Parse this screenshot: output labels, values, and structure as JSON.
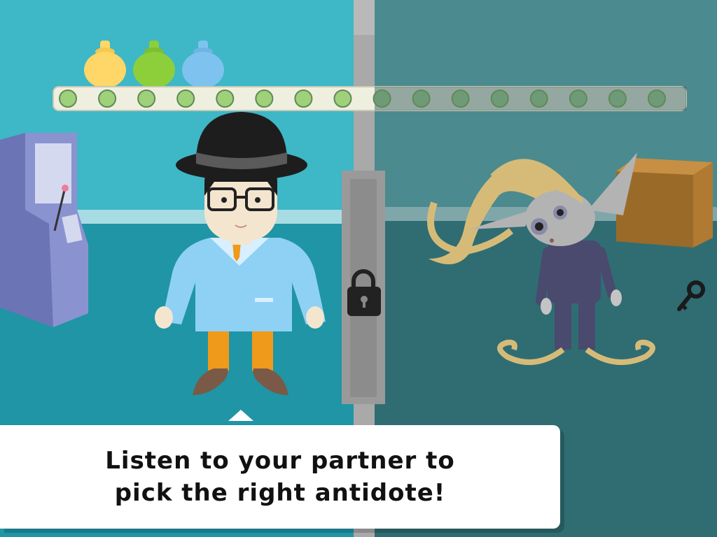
{
  "dialog": {
    "line1": "Listen to your partner to",
    "line2": "pick the right antidote!"
  },
  "antidotes": [
    {
      "name": "yellow-antidote",
      "color": "#ffd668"
    },
    {
      "name": "green-antidote",
      "color": "#8ccf3a"
    },
    {
      "name": "blue-antidote",
      "color": "#7ec3ef"
    }
  ],
  "progress": {
    "total_slots": 16
  },
  "icons": {
    "lock": "lock-icon",
    "key": "key-icon",
    "scroll_up": "triangle-up-icon"
  },
  "colors": {
    "left_wall": "#3eb7c7",
    "left_floor": "#1f95a6",
    "right_wall": "#4b8a8f",
    "right_floor": "#2f6d73",
    "dot_lit": "#9fd07a",
    "dot_dim": "#6f9a78"
  }
}
